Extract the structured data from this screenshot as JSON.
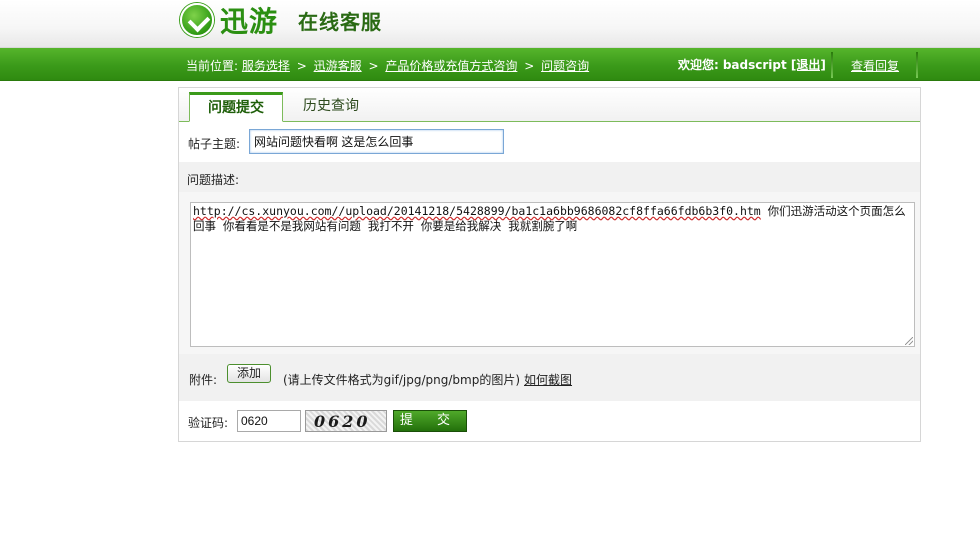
{
  "brand": {
    "logo_text": "迅游",
    "subtitle": "在线客服",
    "accent_color": "#3b9a1a"
  },
  "nav": {
    "location_label": "当前位置:",
    "breadcrumbs": [
      "服务选择",
      "迅游客服",
      "产品价格或充值方式咨询",
      "问题咨询"
    ],
    "separator": ">",
    "welcome_label": "欢迎您:",
    "username": "badscript",
    "logout_label": "[退出]",
    "view_reply_label": "查看回复"
  },
  "tabs": [
    {
      "label": "问题提交",
      "active": true
    },
    {
      "label": "历史查询",
      "active": false
    }
  ],
  "form": {
    "subject_label": "帖子主题:",
    "subject_value": "网站问题快看啊 这是怎么回事",
    "description_label": "问题描述:",
    "description_url": "http://cs.xunyou.com//upload/20141218/5428899/ba1c1a6bb9686082cf8ffa66fdb6b3f0.htm",
    "description_text": "   你们迅游活动这个页面怎么回事 你看看是不是我网站有问题 我打不开   你要是给我解决 我就割腕了啊",
    "attachment_label": "附件:",
    "add_button_label": "添加",
    "attachment_note": "(请上传文件格式为gif/jpg/png/bmp的图片)",
    "how_to_screenshot_label": "如何截图",
    "verify_label": "验证码:",
    "verify_value": "0620",
    "captcha_text": "0620",
    "submit_label": "提 交"
  }
}
